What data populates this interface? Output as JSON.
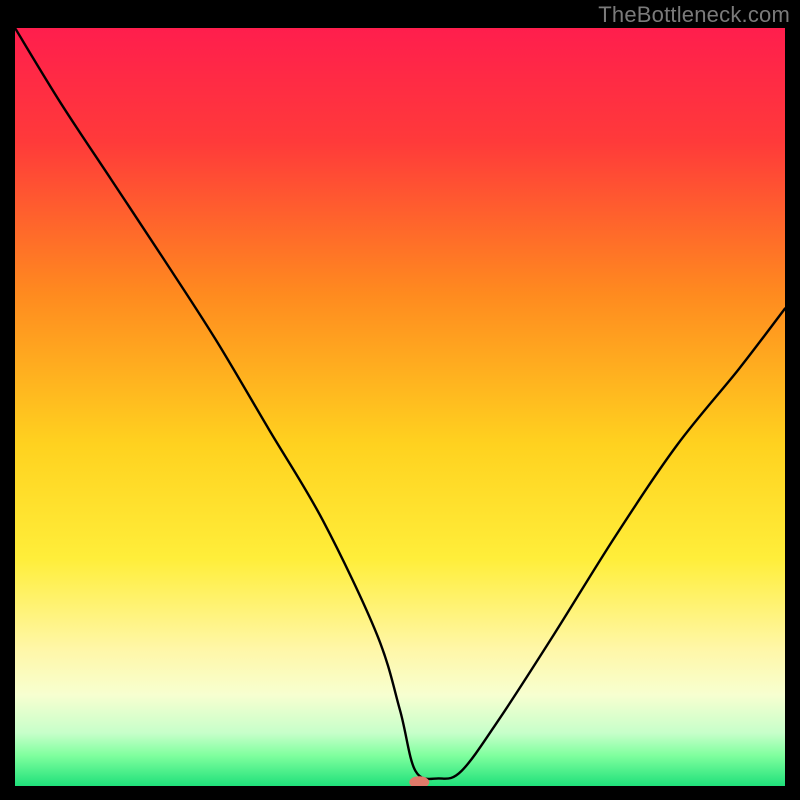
{
  "watermark": "TheBottleneck.com",
  "chart_data": {
    "type": "line",
    "title": "",
    "xlabel": "",
    "ylabel": "",
    "xlim": [
      0,
      100
    ],
    "ylim": [
      0,
      100
    ],
    "background_gradient": [
      {
        "offset": 0.0,
        "color": "#ff1e4d"
      },
      {
        "offset": 0.15,
        "color": "#ff3a3a"
      },
      {
        "offset": 0.35,
        "color": "#ff8a1f"
      },
      {
        "offset": 0.55,
        "color": "#ffd21f"
      },
      {
        "offset": 0.7,
        "color": "#ffee3a"
      },
      {
        "offset": 0.82,
        "color": "#fff7a8"
      },
      {
        "offset": 0.88,
        "color": "#f7ffd0"
      },
      {
        "offset": 0.93,
        "color": "#c7ffca"
      },
      {
        "offset": 0.96,
        "color": "#7fff9e"
      },
      {
        "offset": 1.0,
        "color": "#1fe07a"
      }
    ],
    "series": [
      {
        "name": "bottleneck-curve",
        "x": [
          0,
          6,
          12.5,
          19,
          26,
          33,
          40,
          47,
          50,
          52,
          55,
          58,
          63,
          70,
          78,
          86,
          94,
          100
        ],
        "y": [
          100,
          90,
          80,
          70,
          59,
          47,
          35,
          20,
          10,
          2,
          1,
          2,
          9,
          20,
          33,
          45,
          55,
          63
        ]
      }
    ],
    "marker": {
      "x": 52.5,
      "y": 0.5,
      "color": "#e07a6a"
    }
  }
}
